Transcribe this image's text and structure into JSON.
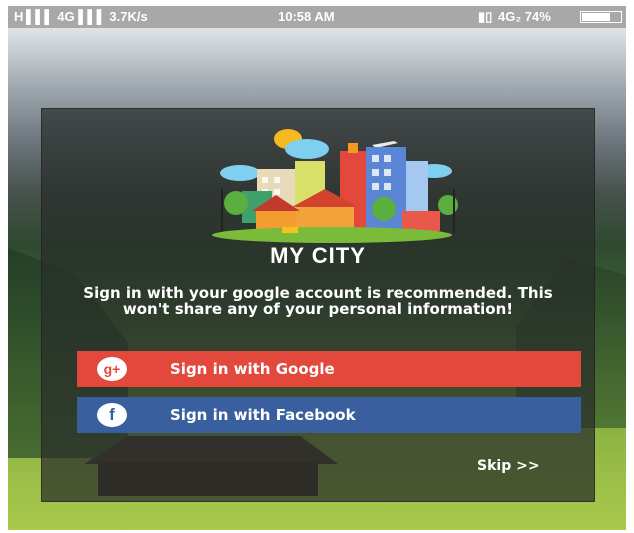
{
  "status_bar": {
    "left": "H ▌▌▌ 4G ▌▌▌  3.7K/s",
    "time": "10:58 AM",
    "right": "4G₂ 74%"
  },
  "app": {
    "title": "MY CITY",
    "message": "Sign in with your google account is recommended. This won't share any of your personal information!",
    "google_icon": "g+",
    "google_label": "Sign in with Google",
    "facebook_icon": "f",
    "facebook_label": "Sign in with Facebook",
    "skip_label": "Skip >>"
  },
  "colors": {
    "google": "#e2483b",
    "facebook": "#3a5f9f",
    "status_bar": "#a8a8a8"
  },
  "icons": [
    "city-logo-icon",
    "google-plus-icon",
    "facebook-icon",
    "battery-icon",
    "signal-icon"
  ]
}
